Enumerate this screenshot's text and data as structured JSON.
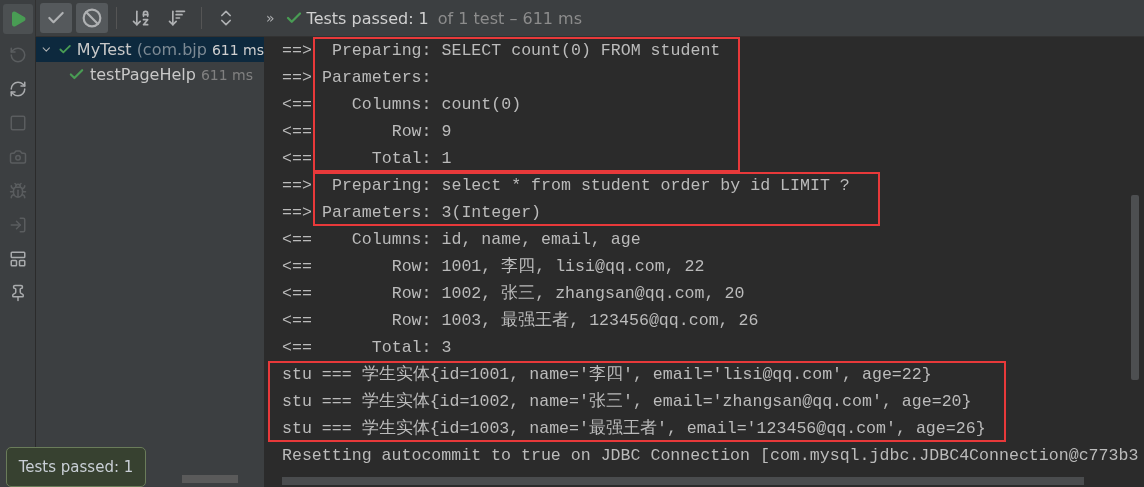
{
  "toolbar": {
    "run": {
      "disabled": false
    },
    "toggles": [
      {
        "kind": "passed",
        "selected": true
      },
      {
        "kind": "ignored",
        "selected": true
      }
    ],
    "actions": [
      {
        "kind": "sort-alpha"
      },
      {
        "kind": "sort-duration"
      },
      {
        "kind": "expand"
      }
    ],
    "overflow": "»",
    "status": {
      "label": "Tests passed: 1",
      "detail": "of 1 test – 611 ms"
    }
  },
  "side_tools": [
    {
      "kind": "rerun-failed",
      "disabled": true
    },
    {
      "kind": "auto-test",
      "disabled": false
    },
    {
      "kind": "stop",
      "disabled": true
    },
    {
      "kind": "snapshot",
      "disabled": true
    },
    {
      "kind": "export",
      "disabled": true
    },
    {
      "kind": "import",
      "disabled": true
    },
    {
      "kind": "layout",
      "disabled": false
    },
    {
      "kind": "pin",
      "disabled": false
    }
  ],
  "tree": [
    {
      "name": "MyTest",
      "detail": "(com.bjp",
      "time": "611 ms",
      "selected": true,
      "expanded": true,
      "children": [
        {
          "name": "testPageHelp",
          "time": "611 ms",
          "selected": false
        }
      ]
    }
  ],
  "console": [
    {
      "boxed": true,
      "lines": [
        {
          "prefix": "==>",
          "text": " Preparing: SELECT count(0) FROM student"
        },
        {
          "prefix": "==>",
          "text": "Parameters: "
        },
        {
          "prefix": "<==",
          "text": "   Columns: count(0)"
        },
        {
          "prefix": "<==",
          "text": "       Row: 9"
        },
        {
          "prefix": "<==",
          "text": "     Total: 1"
        }
      ]
    },
    {
      "boxed": true,
      "lines": [
        {
          "prefix": "==>",
          "text": " Preparing: select * from student order by id LIMIT ? "
        },
        {
          "prefix": "==>",
          "text": "Parameters: 3(Integer)"
        }
      ]
    },
    {
      "boxed": false,
      "lines": [
        {
          "prefix": "<==",
          "text": "   Columns: id, name, email, age"
        },
        {
          "prefix": "<==",
          "text": "       Row: 1001, 李四, lisi@qq.com, 22"
        },
        {
          "prefix": "<==",
          "text": "       Row: 1002, 张三, zhangsan@qq.com, 20"
        },
        {
          "prefix": "<==",
          "text": "       Row: 1003, 最强王者, 123456@qq.com, 26"
        },
        {
          "prefix": "<==",
          "text": "     Total: 3"
        }
      ]
    },
    {
      "boxed": true,
      "lines": [
        {
          "text": "stu === 学生实体{id=1001, name='李四', email='lisi@qq.com', age=22}"
        },
        {
          "text": "stu === 学生实体{id=1002, name='张三', email='zhangsan@qq.com', age=20}"
        },
        {
          "text": "stu === 学生实体{id=1003, name='最强王者', email='123456@qq.com', age=26}"
        }
      ]
    },
    {
      "boxed": false,
      "lines": [
        {
          "text": "Resetting autocommit to true on JDBC Connection [com.mysql.jdbc.JDBC4Connection@c773b3"
        }
      ]
    }
  ],
  "toast": {
    "text": "Tests passed: 1"
  }
}
